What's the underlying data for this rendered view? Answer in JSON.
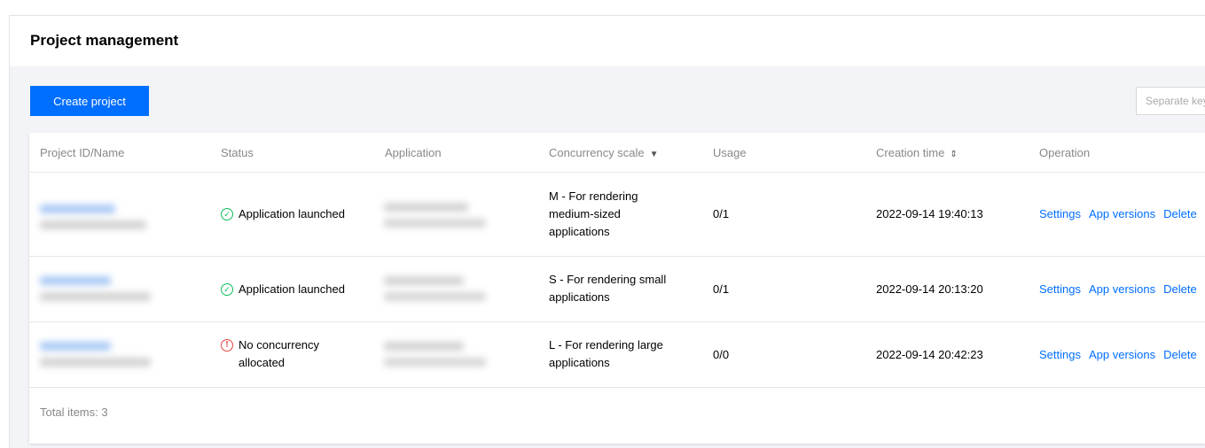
{
  "header": {
    "title": "Project management"
  },
  "toolbar": {
    "create_label": "Create project",
    "search_placeholder": "Separate keywords with \"|\""
  },
  "table": {
    "columns": {
      "project": "Project ID/Name",
      "status": "Status",
      "application": "Application",
      "concurrency": "Concurrency scale",
      "usage": "Usage",
      "creation_time": "Creation time",
      "operation": "Operation"
    },
    "column_icons": {
      "concurrency": "filter-icon",
      "creation_time": "sort-icon"
    },
    "rows": [
      {
        "status": "Application launched",
        "status_icon": "check-circle-icon",
        "concurrency": [
          "M - For rendering",
          "medium-sized",
          "applications"
        ],
        "usage": "0/1",
        "created": "2022-09-14 19:40:13"
      },
      {
        "status": "Application launched",
        "status_icon": "check-circle-icon",
        "concurrency": [
          "S - For rendering small",
          "applications"
        ],
        "usage": "0/1",
        "created": "2022-09-14 20:13:20"
      },
      {
        "status": "No concurrency allocated",
        "status_icon": "warning-circle-icon",
        "concurrency": [
          "L - For rendering large",
          "applications"
        ],
        "usage": "0/0",
        "created": "2022-09-14 20:42:23"
      }
    ],
    "operations": {
      "settings": "Settings",
      "versions": "App versions",
      "delete": "Delete"
    },
    "footer": {
      "total_label": "Total items:",
      "total_count": "3"
    }
  },
  "colors": {
    "primary": "#006eff",
    "success": "#0abf5b",
    "danger": "#e54545",
    "page_bg": "#f3f4f7"
  }
}
